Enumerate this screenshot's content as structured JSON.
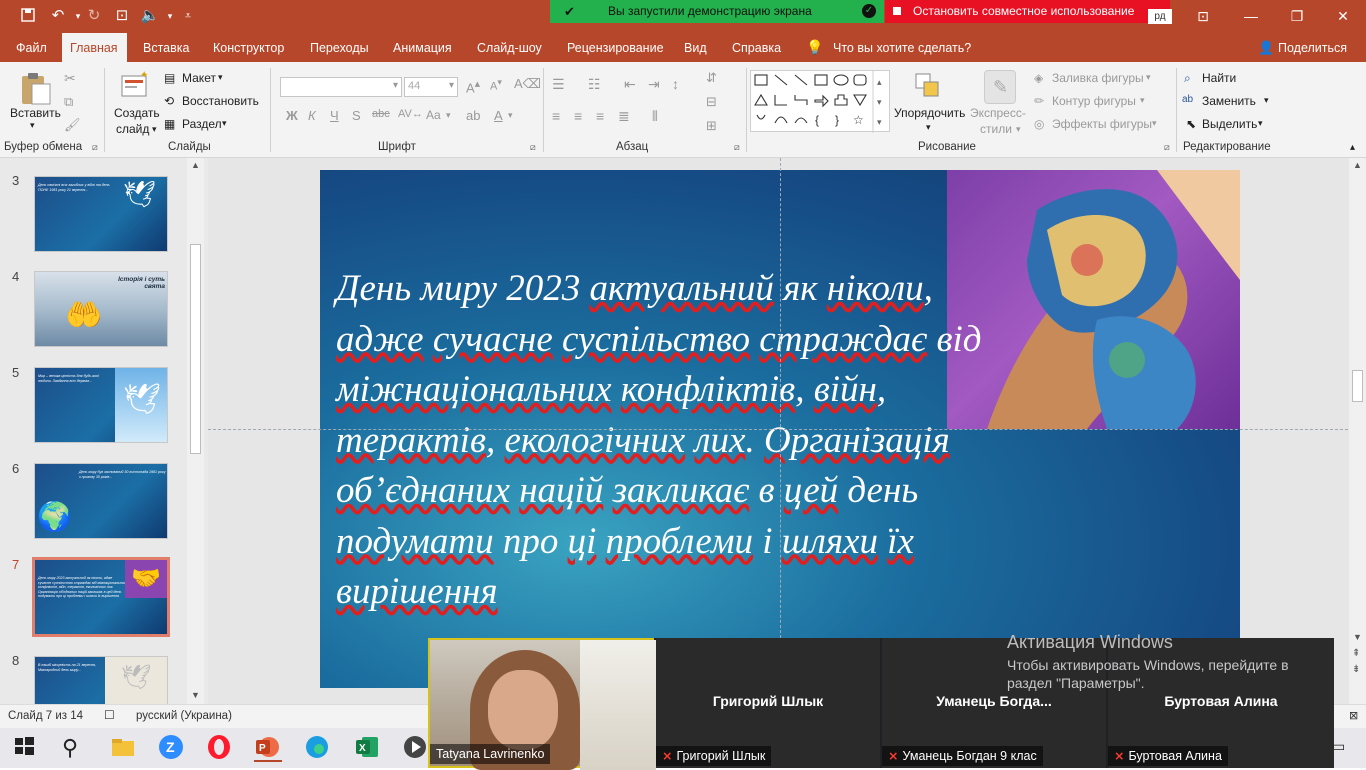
{
  "screen_share": {
    "running_label": "Вы запустили демонстрацию экрана",
    "stop_label": "Остановить совместное использование",
    "hidden_text": "рд"
  },
  "tabs": [
    {
      "label": "Файл"
    },
    {
      "label": "Главная"
    },
    {
      "label": "Вставка"
    },
    {
      "label": "Конструктор"
    },
    {
      "label": "Переходы"
    },
    {
      "label": "Анимация"
    },
    {
      "label": "Слайд-шоу"
    },
    {
      "label": "Рецензирование"
    },
    {
      "label": "Вид"
    },
    {
      "label": "Справка"
    }
  ],
  "tell_me": "Что вы хотите сделать?",
  "share_label": "Поделиться",
  "ribbon": {
    "clipboard": {
      "paste": "Вставить",
      "group": "Буфер обмена"
    },
    "slides": {
      "new_slide": "Создать",
      "new_slide_2": "слайд",
      "layout": "Макет",
      "reset": "Восстановить",
      "section": "Раздел",
      "group": "Слайды"
    },
    "font": {
      "size": "44",
      "group": "Шрифт",
      "bold": "Ж",
      "italic": "К",
      "underline": "Ч",
      "strike": "S",
      "case": "Aa"
    },
    "paragraph": {
      "group": "Абзац"
    },
    "drawing": {
      "arrange": "Упорядочить",
      "quick_styles": "Экспресс-",
      "quick_styles_2": "стили",
      "fill": "Заливка фигуры",
      "outline": "Контур фигуры",
      "effects": "Эффекты фигуры",
      "group": "Рисование"
    },
    "editing": {
      "find": "Найти",
      "replace": "Заменить",
      "select": "Выделить",
      "group": "Редактирование"
    }
  },
  "thumbnails": [
    {
      "num": "3",
      "text": "День пам'яті всіх загиблих у війні та день ПОНЕ 1981 року 21 вересня..."
    },
    {
      "num": "4",
      "text": "Історія і суть свята"
    },
    {
      "num": "5",
      "text": "Мир – велика цінність для будь-якої людини. Завдання всіх держав..."
    },
    {
      "num": "6",
      "text": "День миру був заснований 30 листопада 1981 року з призову 30 років..."
    },
    {
      "num": "7",
      "text": "День миру 2023 актуальний як ніколи, адже сучасне суспільство страждає від міжнаціональних конфліктів, війн, терактів, екологічних лих. Організація об'єднаних націй закликає в цей день подумати про ці проблеми і шляхи їх вирішення"
    },
    {
      "num": "8",
      "text": "В нашій місцевість на 21 вересня, Міжнародний день миру..."
    }
  ],
  "slide_text_parts": {
    "p1": "День миру 2023 ",
    "p2": "актуальний",
    "p3": " як ",
    "p4": "ніколи",
    "p5": ", ",
    "p6": "адже",
    "p7": " ",
    "p8": "сучасне",
    "p9": " ",
    "p10": "суспільство",
    "p11": " ",
    "p12": "страждає",
    "p13": " від ",
    "p14": "міжнаціональних",
    "p15": " ",
    "p16": "конфліктів",
    "p17": ", ",
    "p18": "війн",
    "p19": ", ",
    "p20": "терактів",
    "p21": ", ",
    "p22": "екологічних",
    "p23": " ",
    "p24": "лих",
    "p25": ". ",
    "p26": "Організація",
    "p27": " ",
    "p28": "об’єднаних",
    "p29": " ",
    "p30": "націй",
    "p31": " ",
    "p32": "закликає",
    "p33": " в ",
    "p34": "цей",
    "p35": " день ",
    "p36": "подумати",
    "p37": " про ",
    "p38": "ці",
    "p39": " ",
    "p40": "проблеми",
    "p41": " і ",
    "p42": "шляхи",
    "p43": " ",
    "p44": "їх",
    "p45": " ",
    "p46": "вирішення"
  },
  "status": {
    "slide": "Слайд 7 из 14",
    "language": "русский (Украина)"
  },
  "video": [
    {
      "name": "Tatyana Lavrinenko"
    },
    {
      "name": "Григорий Шлык",
      "tag": "Григорий Шлык"
    },
    {
      "name": "Уманець  Богда...",
      "tag": "Уманець Богдан 9 клас"
    },
    {
      "name": "Буртовая Алина",
      "tag": "Буртовая Алина"
    }
  ],
  "activation": {
    "title": "Активация Windows",
    "line1": "Чтобы активировать Windows, перейдите в",
    "line2": "раздел \"Параметры\"."
  },
  "colors": {
    "accent": "#b7472a",
    "share_green": "#22b14c",
    "share_red": "#e81123",
    "selected_thumb": "#e07e6b"
  }
}
